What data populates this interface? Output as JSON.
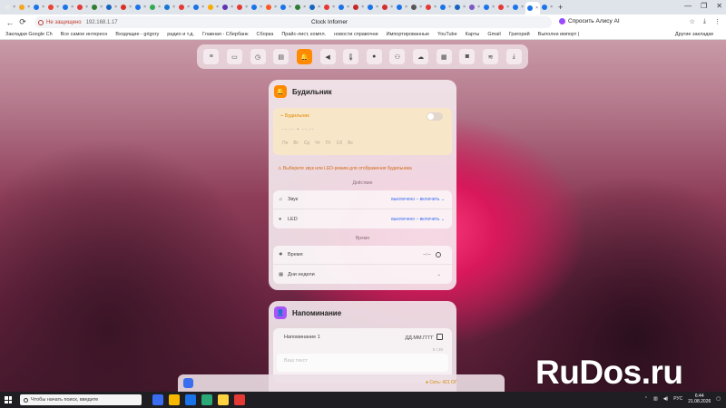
{
  "browser": {
    "tabs": [
      {
        "icon_color": "#e8e8e8"
      },
      {
        "icon_color": "#f5a623"
      },
      {
        "icon_color": "#1a73e8"
      },
      {
        "icon_color": "#ea4335"
      },
      {
        "icon_color": "#1a73e8"
      },
      {
        "icon_color": "#e53935"
      },
      {
        "icon_color": "#2e7d32"
      },
      {
        "icon_color": "#1565c0"
      },
      {
        "icon_color": "#d93025"
      },
      {
        "icon_color": "#1a73e8"
      },
      {
        "icon_color": "#34a853"
      },
      {
        "icon_color": "#1976d2"
      },
      {
        "icon_color": "#e53935"
      },
      {
        "icon_color": "#1a73e8"
      },
      {
        "icon_color": "#f9ab00"
      },
      {
        "icon_color": "#5e35b1"
      },
      {
        "icon_color": "#e53935"
      },
      {
        "icon_color": "#1a73e8"
      },
      {
        "icon_color": "#ff5722"
      },
      {
        "icon_color": "#1a73e8"
      },
      {
        "icon_color": "#2e7d32"
      },
      {
        "icon_color": "#1565c0"
      },
      {
        "icon_color": "#e53935"
      },
      {
        "icon_color": "#1a73e8"
      },
      {
        "icon_color": "#c62828"
      },
      {
        "icon_color": "#1a73e8"
      },
      {
        "icon_color": "#d32f2f"
      },
      {
        "icon_color": "#1a73e8"
      },
      {
        "icon_color": "#555555"
      },
      {
        "icon_color": "#e53935"
      },
      {
        "icon_color": "#1a73e8"
      },
      {
        "icon_color": "#1565c0"
      },
      {
        "icon_color": "#7e57c2"
      },
      {
        "icon_color": "#1a73e8"
      },
      {
        "icon_color": "#e53935"
      },
      {
        "icon_color": "#1a73e8"
      },
      {
        "icon_color": "#1a73e8"
      },
      {
        "icon_color": "#1a73e8"
      }
    ],
    "new_tab": "+",
    "window_controls": {
      "minimize": "—",
      "maximize": "❐",
      "close": "✕"
    },
    "back": "←",
    "reload": "⟳",
    "not_secure": "Не защищено",
    "url": "192.168.1.17",
    "page_title": "Clock Infomer",
    "ask_ai": "Спросить Алису AI",
    "addr_right": [
      "☆",
      "⤓",
      "⋮"
    ],
    "bookmarks": [
      "Закладки Google Ch",
      "Все самое интересн",
      "Входящие - grigory",
      "радио и т.д.",
      "Главная - Сбербанк",
      "Сборка",
      "Прайс-лист, компл.",
      "новости справочни",
      "Импортированные",
      "YouTube",
      "Карты",
      "Gmail",
      "Григорий",
      "Выполни импорт |"
    ],
    "other_bookmarks": "Другие закладки"
  },
  "app": {
    "toolbar": [
      {
        "icon": "menu-icon",
        "glyph": "≡"
      },
      {
        "icon": "monitor-icon",
        "glyph": "▭"
      },
      {
        "icon": "clock-icon",
        "glyph": "◷"
      },
      {
        "icon": "display-icon",
        "glyph": "▤"
      },
      {
        "icon": "bell-icon",
        "glyph": "🔔",
        "active": true
      },
      {
        "icon": "speaker-icon",
        "glyph": "◀"
      },
      {
        "icon": "thermometer-icon",
        "glyph": "🌡"
      },
      {
        "icon": "bulb-icon",
        "glyph": "●"
      },
      {
        "icon": "network-icon",
        "glyph": "⚇"
      },
      {
        "icon": "cloud-icon",
        "glyph": "☁"
      },
      {
        "icon": "calendar-icon",
        "glyph": "▦"
      },
      {
        "icon": "chat-icon",
        "glyph": "◙"
      },
      {
        "icon": "wifi-icon",
        "glyph": "≋"
      },
      {
        "icon": "download-icon",
        "glyph": "⤓"
      }
    ],
    "accent_color": "#ff8a00",
    "alarm_card": {
      "title": "Будильник",
      "alarm_label": "Будильник",
      "time": "--.-- • --.--",
      "days": [
        "Пн",
        "Вт",
        "Ср",
        "Чт",
        "Пт",
        "Сб",
        "Вс"
      ],
      "warning": "Выберите звук или LED-режим для отображения будильника",
      "section_actions": "Действие",
      "sound_label": "Звук",
      "sound_value": "выключено – включить",
      "led_label": "LED",
      "led_value": "выключено – включить",
      "section_time": "Время",
      "time_label": "Время",
      "time_value": "--:--",
      "weekday_label": "Дни недели"
    },
    "reminder_card": {
      "title": "Напоминание",
      "item_label": "Напоминание 1",
      "date_placeholder": "ДД.ММ.ГГГГ",
      "char_count": "0 / 20",
      "text_placeholder": "Ваш текст"
    },
    "status_text": "Сеть: 421 ОГ"
  },
  "watermark": "RuDos.ru",
  "taskbar": {
    "search_placeholder": "Чтобы начать поиск, введите",
    "apps": [
      "#3a6df0",
      "#f5b700",
      "#1a73e8",
      "#2aa876",
      "#ffd23f",
      "#e53935"
    ],
    "lang": "РУС",
    "time": "6:44",
    "date": "21.08.2026"
  }
}
